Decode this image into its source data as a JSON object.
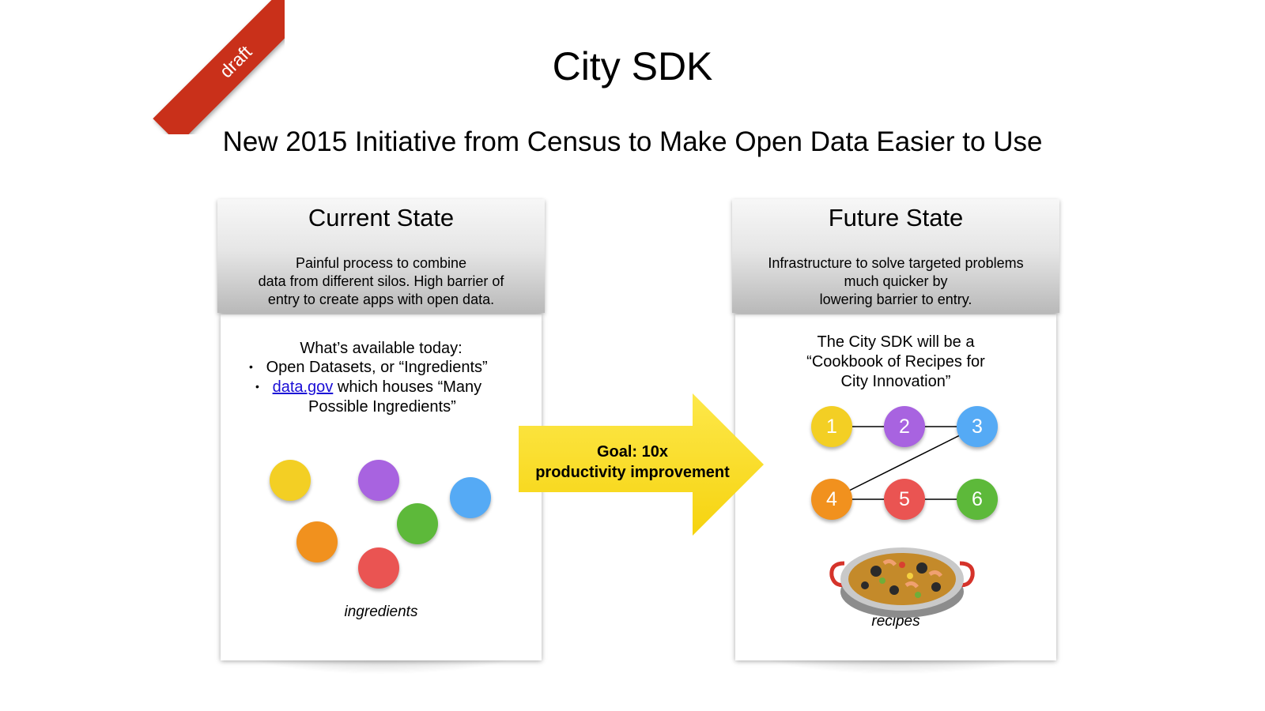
{
  "ribbon": {
    "label": "draft",
    "color": "#c9301a"
  },
  "title": "City SDK",
  "subtitle": "New 2015 Initiative from Census to Make Open Data Easier to Use",
  "current_state": {
    "title": "Current State",
    "desc_lines": [
      "Painful process to combine",
      "data from different silos.  High barrier of",
      "entry to create apps with open data."
    ],
    "available_heading": "What’s available today:",
    "bullet_1": "Open Datasets, or “Ingredients”",
    "bullet_2_link": "data.gov",
    "bullet_2_rest": " which houses “Many",
    "bullet_2_cont": "Possible Ingredients”",
    "caption": "ingredients",
    "ingredient_colors": [
      "#f3cf24",
      "#a863e0",
      "#55aaf5",
      "#f1911e",
      "#5db93a",
      "#ea5452"
    ]
  },
  "arrow": {
    "line1": "Goal: 10x",
    "line2": "productivity improvement",
    "color": "#fbdc1c"
  },
  "future_state": {
    "title": "Future State",
    "desc_lines": [
      "Infrastructure to solve targeted problems",
      "much quicker by",
      "lowering barrier to entry."
    ],
    "sdk_lines": [
      "The City SDK will be a",
      "“Cookbook of Recipes for",
      "City Innovation”"
    ],
    "nodes": [
      {
        "label": "1",
        "color": "#f3cf24"
      },
      {
        "label": "2",
        "color": "#a863e0"
      },
      {
        "label": "3",
        "color": "#55aaf5"
      },
      {
        "label": "4",
        "color": "#f1911e"
      },
      {
        "label": "5",
        "color": "#ea5452"
      },
      {
        "label": "6",
        "color": "#5db93a"
      }
    ],
    "image": "paella-pan-image",
    "caption": "recipes"
  }
}
